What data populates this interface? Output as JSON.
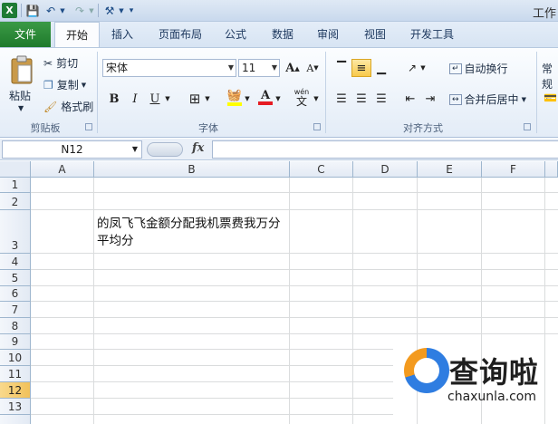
{
  "window": {
    "title_partial": "工作"
  },
  "ribbon_tabs": [
    {
      "label": "文件"
    },
    {
      "label": "开始"
    },
    {
      "label": "插入"
    },
    {
      "label": "页面布局"
    },
    {
      "label": "公式"
    },
    {
      "label": "数据"
    },
    {
      "label": "审阅"
    },
    {
      "label": "视图"
    },
    {
      "label": "开发工具"
    }
  ],
  "clipboard": {
    "paste": "粘贴",
    "cut": "剪切",
    "copy": "复制",
    "format_painter": "格式刷",
    "group_label": "剪贴板"
  },
  "font": {
    "name": "宋体",
    "size": "11",
    "grow": "A",
    "shrink": "A",
    "bold": "B",
    "italic": "I",
    "underline": "U",
    "group_label": "字体",
    "phonetic": "wén"
  },
  "alignment": {
    "wrap_text": "自动换行",
    "merge_center": "合并后居中",
    "group_label": "对齐方式"
  },
  "number": {
    "format_partial": "常规"
  },
  "formula_bar": {
    "name_box": "N12",
    "fx": "fx",
    "value": ""
  },
  "columns": [
    "A",
    "B",
    "C",
    "D",
    "E",
    "F"
  ],
  "rows": [
    "1",
    "2",
    "3",
    "4",
    "5",
    "6",
    "7",
    "8",
    "9",
    "10",
    "11",
    "12",
    "13"
  ],
  "selected_row": "12",
  "cells": {
    "B3": "的凤飞飞金额分配我机票费我万分平均分"
  },
  "watermark": {
    "title": "查询啦",
    "url": "chaxunla.com"
  },
  "colors": {
    "file_tab": "#2b8a38",
    "selected_row_header": "#f5c96a",
    "fill_highlight": "#ffff00",
    "font_color_bar": "#e51c23"
  }
}
